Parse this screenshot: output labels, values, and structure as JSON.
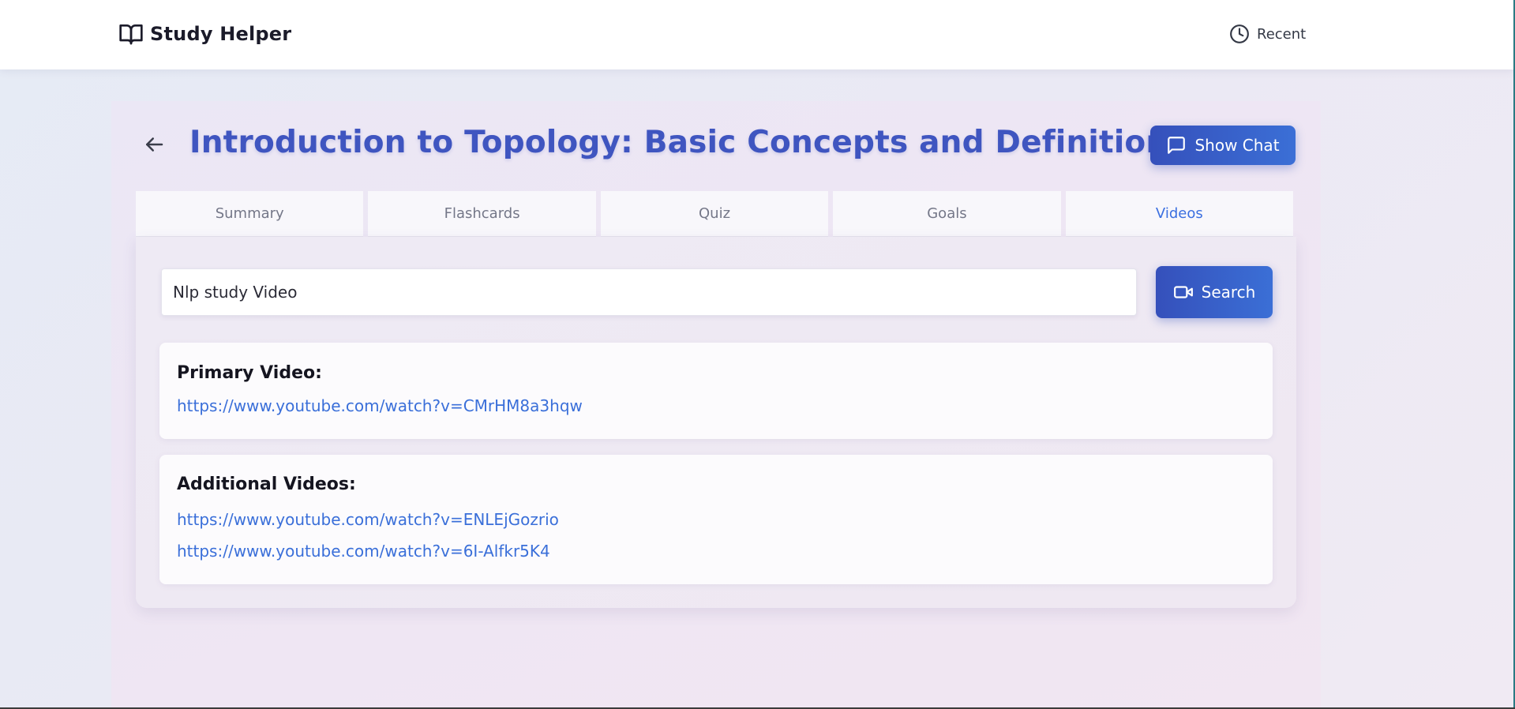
{
  "header": {
    "brand_icon": "book-open-icon",
    "brand_title": "Study Helper",
    "recent_icon": "clock-icon",
    "recent_label": "Recent"
  },
  "page": {
    "back_icon": "arrow-left-icon",
    "title": "Introduction to Topology: Basic Concepts and Definitions",
    "show_chat_icon": "chat-bubble-icon",
    "show_chat_label": "Show Chat"
  },
  "tabs": [
    {
      "label": "Summary",
      "active": false
    },
    {
      "label": "Flashcards",
      "active": false
    },
    {
      "label": "Quiz",
      "active": false
    },
    {
      "label": "Goals",
      "active": false
    },
    {
      "label": "Videos",
      "active": true
    }
  ],
  "search": {
    "value": "Nlp study Video",
    "button_icon": "video-camera-icon",
    "button_label": "Search"
  },
  "primary": {
    "heading": "Primary Video:",
    "link": "https://www.youtube.com/watch?v=CMrHM8a3hqw"
  },
  "additional": {
    "heading": "Additional Videos:",
    "links": [
      "https://www.youtube.com/watch?v=ENLEjGozrio",
      "https://www.youtube.com/watch?v=6I-Alfkr5K4"
    ]
  },
  "colors": {
    "accent": "#3f55c0",
    "link": "#3a6fd9",
    "active_tab": "#3b6fe0"
  }
}
